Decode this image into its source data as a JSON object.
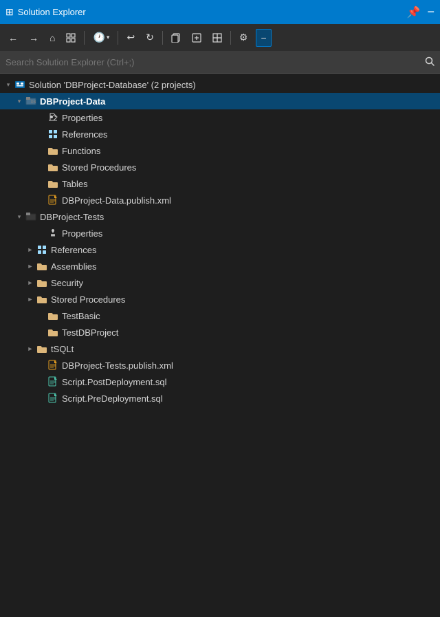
{
  "titleBar": {
    "title": "Solution Explorer",
    "pin_label": "📌",
    "close_label": "−"
  },
  "toolbar": {
    "back_label": "←",
    "forward_label": "→",
    "home_label": "⌂",
    "toggle_label": "⊞",
    "history_label": "🕐",
    "history_arrow": "▾",
    "undo_label": "↩",
    "refresh_label": "↻",
    "copy_label": "⊟",
    "copy2_label": "⊡",
    "copy3_label": "⊞",
    "settings_label": "⚙",
    "minus_label": "−"
  },
  "search": {
    "placeholder": "Search Solution Explorer (Ctrl+;)"
  },
  "tree": {
    "solution_label": "Solution 'DBProject-Database' (2 projects)",
    "project1": {
      "label": "DBProject-Data",
      "children": {
        "properties": "Properties",
        "references": "References",
        "functions": "Functions",
        "stored_procedures": "Stored Procedures",
        "tables": "Tables",
        "publish_xml": "DBProject-Data.publish.xml"
      }
    },
    "project2": {
      "label": "DBProject-Tests",
      "children": {
        "properties": "Properties",
        "references": "References",
        "assemblies": "Assemblies",
        "security": "Security",
        "stored_procedures": "Stored Procedures",
        "test_basic": "TestBasic",
        "test_dbproject": "TestDBProject",
        "tsqlt": "tSQLt",
        "publish_xml": "DBProject-Tests.publish.xml",
        "script_post": "Script.PostDeployment.sql",
        "script_pre": "Script.PreDeployment.sql"
      }
    }
  }
}
